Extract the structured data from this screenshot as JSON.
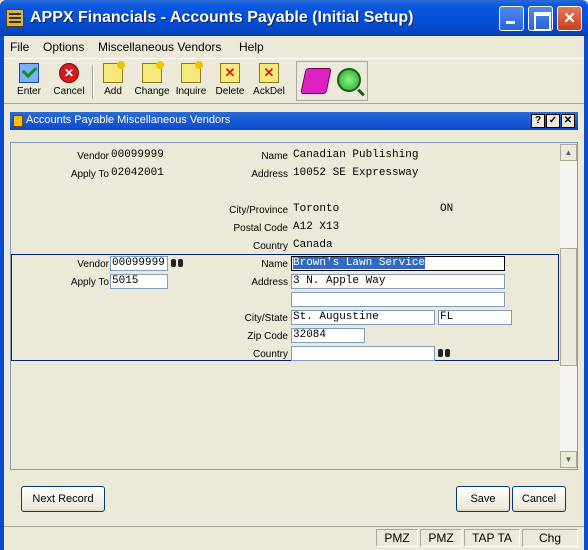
{
  "window": {
    "title": "APPX Financials - Accounts Payable (Initial Setup)"
  },
  "menu": [
    "File",
    "Options",
    "Miscellaneous Vendors",
    "Help"
  ],
  "toolbar": {
    "enter": "Enter",
    "cancel": "Cancel",
    "add": "Add",
    "change": "Change",
    "inquire": "Inquire",
    "delete": "Delete",
    "ackdel": "AckDel"
  },
  "inner": {
    "title": "Accounts Payable Miscellaneous Vendors",
    "help_btn": "?"
  },
  "record1": {
    "vendor_label": "Vendor",
    "vendor": "00099999",
    "apply_label": "Apply To",
    "apply": "02042001",
    "name_label": "Name",
    "name": "Canadian Publishing",
    "address_label": "Address",
    "address": "10052 SE Expressway",
    "city_label": "City/Province",
    "city": "Toronto",
    "province": "ON",
    "postal_label": "Postal Code",
    "postal": "A12 X13",
    "country_label": "Country",
    "country": "Canada"
  },
  "record2": {
    "vendor_label": "Vendor",
    "vendor": "00099999",
    "apply_label": "Apply To",
    "apply": "5015",
    "name_label": "Name",
    "name": "Brown's Lawn Service",
    "address_label": "Address",
    "address1": "3 N. Apple Way",
    "address2": "",
    "city_label": "City/State",
    "city": "St. Augustine",
    "state": "FL",
    "zip_label": "Zip Code",
    "zip": "32084",
    "country_label": "Country",
    "country": ""
  },
  "buttons": {
    "next_record": "Next Record",
    "save": "Save",
    "cancel": "Cancel"
  },
  "status": [
    "PMZ",
    "PMZ",
    "TAP TA",
    "Chg"
  ]
}
